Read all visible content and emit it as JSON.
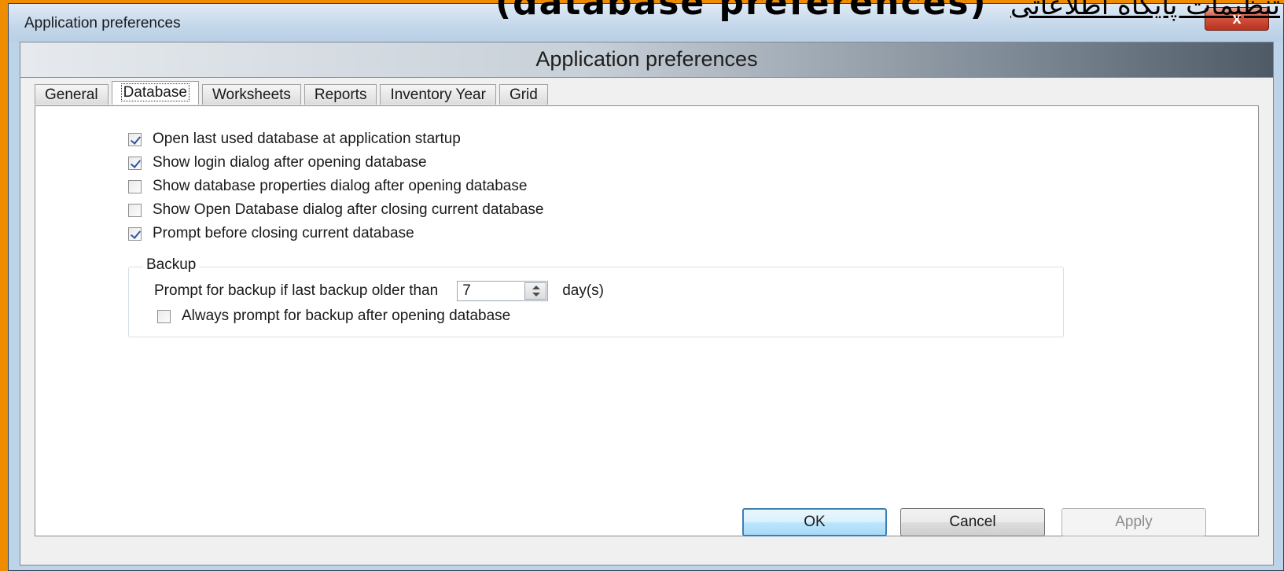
{
  "overlay_caption": {
    "latin": "(database preferences)",
    "arabic": "تنظیمات پایگاه اطلاعاتی"
  },
  "window": {
    "title": "Application preferences",
    "close_glyph": "x",
    "header_title": "Application preferences"
  },
  "tabs": [
    {
      "label": "General"
    },
    {
      "label": "Database",
      "active": true
    },
    {
      "label": "Worksheets"
    },
    {
      "label": "Reports"
    },
    {
      "label": "Inventory Year"
    },
    {
      "label": "Grid"
    }
  ],
  "options": [
    {
      "label": "Open last used database at application startup",
      "checked": true
    },
    {
      "label": "Show login dialog after opening database",
      "checked": true
    },
    {
      "label": "Show database properties dialog after opening database",
      "checked": false
    },
    {
      "label": "Show Open Database dialog after closing current database",
      "checked": false
    },
    {
      "label": "Prompt before closing current database",
      "checked": true
    }
  ],
  "backup": {
    "legend": "Backup",
    "prompt_label": "Prompt for backup if last backup older than",
    "days_value": "7",
    "unit_label": "day(s)",
    "always_prompt_label": "Always prompt for backup after opening database",
    "always_prompt_checked": false
  },
  "buttons": {
    "ok": "OK",
    "cancel": "Cancel",
    "apply": "Apply"
  }
}
